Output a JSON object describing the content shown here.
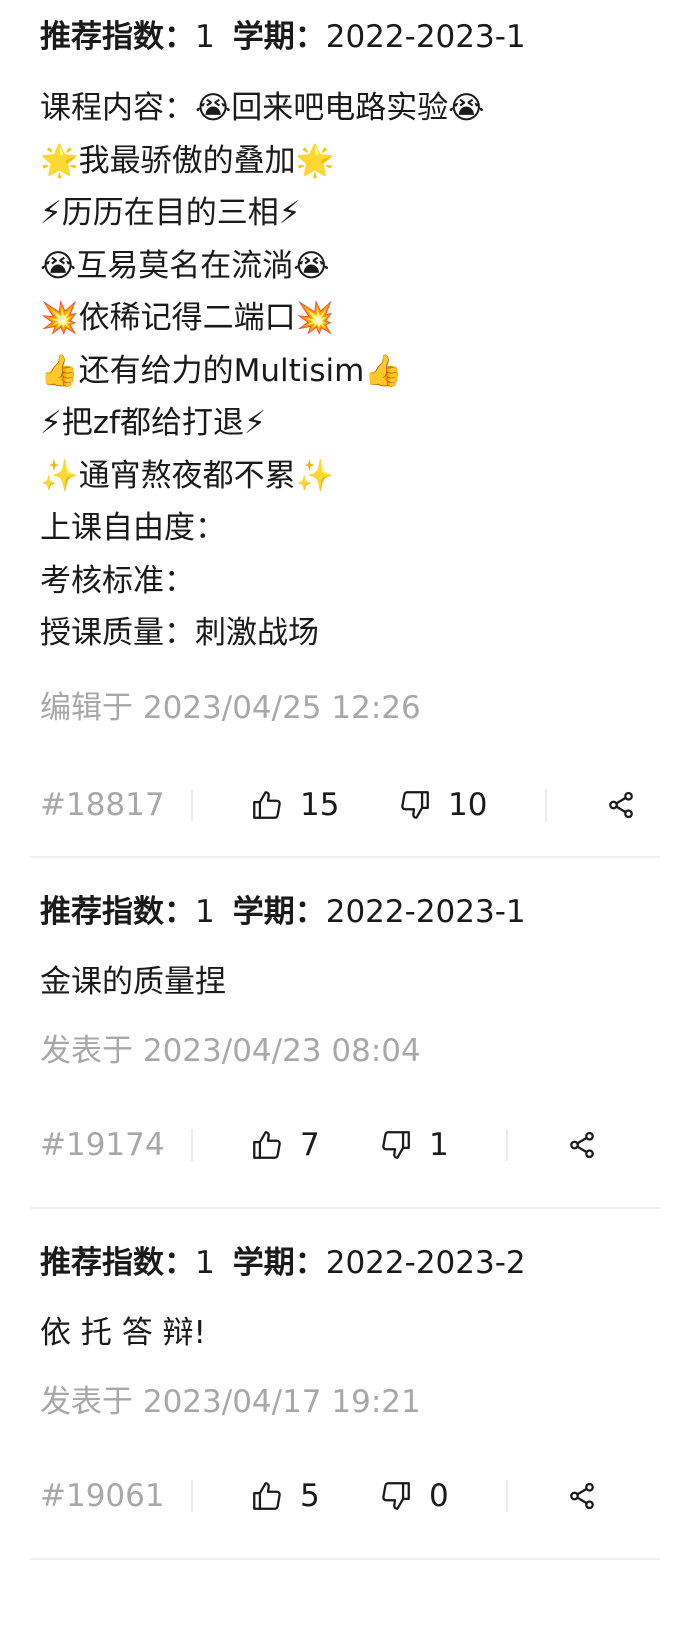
{
  "labels": {
    "recommend_key": "推荐指数：",
    "term_key": "学期：",
    "thumbs_up_icon": "thumbs-up-icon",
    "thumbs_down_icon": "thumbs-down-icon",
    "share_icon": "share-icon"
  },
  "reviews": [
    {
      "recommend": "1",
      "term": "2022-2023-1",
      "content": "课程内容：😭回来吧电路实验😭\n🌟我最骄傲的叠加🌟\n⚡历历在目的三相⚡\n😭互易莫名在流淌😭\n💥依稀记得二端口💥\n👍还有给力的Multisim👍\n⚡把zf都给打退⚡\n✨通宵熬夜都不累✨\n上课自由度：\n考核标准：\n授课质量：刺激战场",
      "posted": "编辑于 2023/04/25 12:26",
      "id": "#18817",
      "likes": "15",
      "dislikes": "10"
    },
    {
      "recommend": "1",
      "term": "2022-2023-1",
      "content": "金课的质量捏",
      "posted": "发表于 2023/04/23 08:04",
      "id": "#19174",
      "likes": "7",
      "dislikes": "1"
    },
    {
      "recommend": "1",
      "term": "2022-2023-2",
      "content": "依 托 答 辩!",
      "posted": "发表于 2023/04/17 19:21",
      "id": "#19061",
      "likes": "5",
      "dislikes": "0"
    }
  ]
}
